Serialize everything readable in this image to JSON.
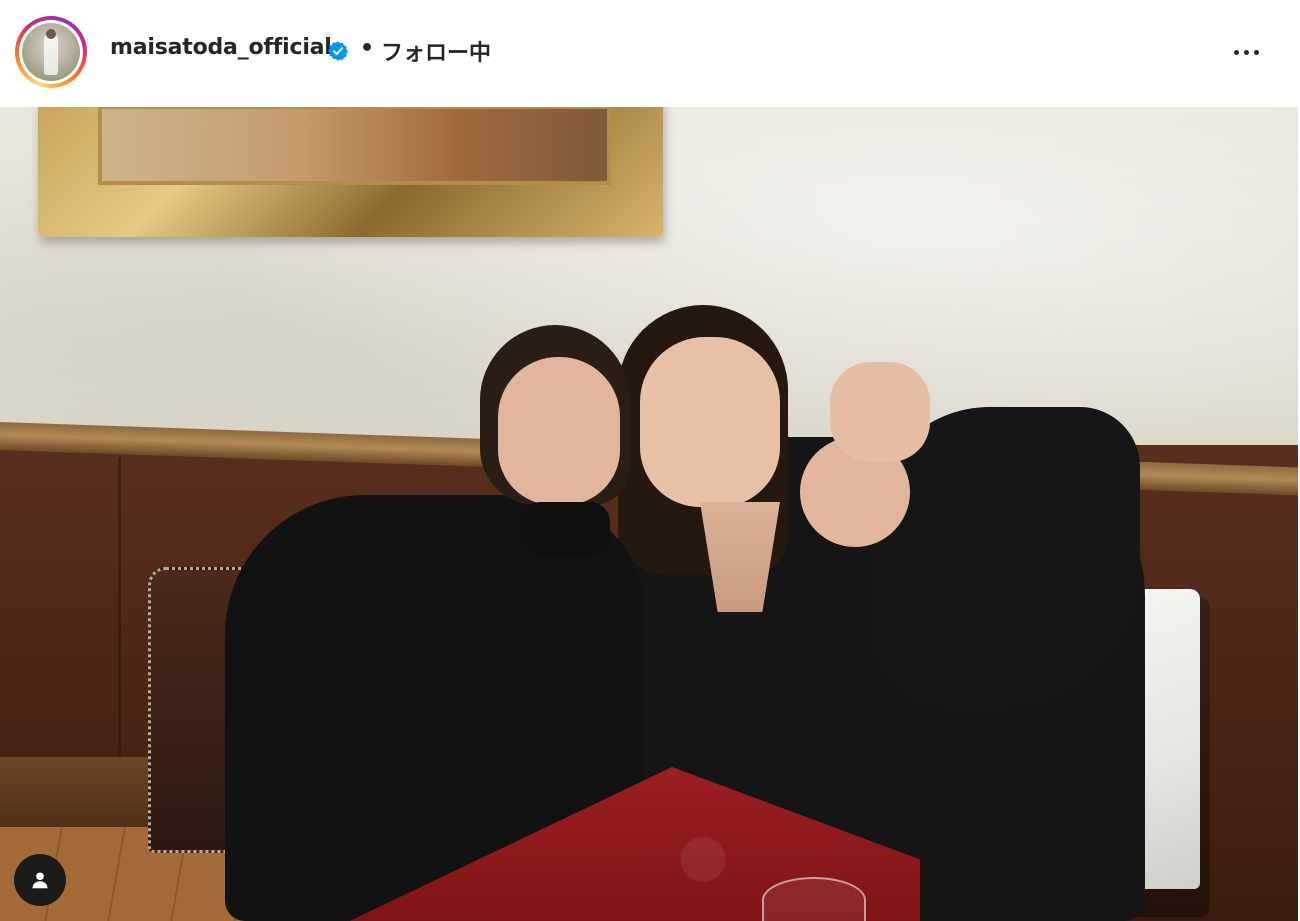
{
  "post": {
    "header": {
      "username": "maisatoda_official",
      "separator": "•",
      "follow_status": "フォロー中",
      "verified": true,
      "more_icon": "more-horizontal-icon"
    },
    "tag_icon": "person-icon",
    "colors": {
      "verified_blue": "#0095f6",
      "text_primary": "#262626",
      "story_ring": [
        "#feda75",
        "#fa7e1e",
        "#d62976",
        "#962fbf"
      ]
    }
  }
}
